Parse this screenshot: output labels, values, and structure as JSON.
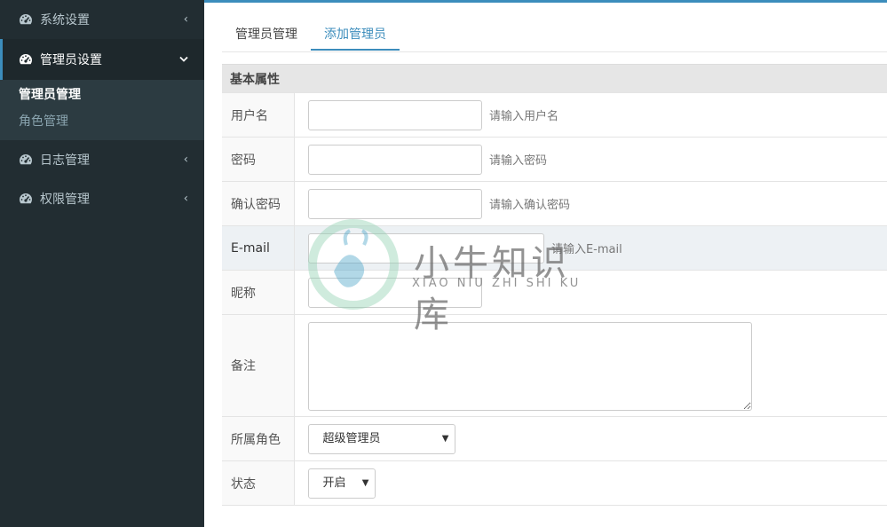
{
  "sidebar": {
    "items": [
      {
        "label": "系统设置",
        "caret": "‹"
      },
      {
        "label": "管理员设置",
        "caret": "⌄"
      },
      {
        "label": "日志管理",
        "caret": "‹"
      },
      {
        "label": "权限管理",
        "caret": "‹"
      }
    ],
    "submenu": [
      {
        "label": "管理员管理",
        "active": true
      },
      {
        "label": "角色管理",
        "active": false
      }
    ]
  },
  "tabs": [
    {
      "label": "管理员管理",
      "active": false
    },
    {
      "label": "添加管理员",
      "active": true
    }
  ],
  "form": {
    "section": "基本属性",
    "username": {
      "label": "用户名",
      "value": "",
      "hint": "请输入用户名"
    },
    "password": {
      "label": "密码",
      "value": "",
      "hint": "请输入密码"
    },
    "confirm": {
      "label": "确认密码",
      "value": "",
      "hint": "请输入确认密码"
    },
    "email": {
      "label": "E-mail",
      "value": "",
      "hint": "请输入E-mail"
    },
    "nickname": {
      "label": "昵称",
      "value": ""
    },
    "remark": {
      "label": "备注",
      "value": ""
    },
    "role": {
      "label": "所属角色",
      "selected": "超级管理员"
    },
    "status": {
      "label": "状态",
      "selected": "开启"
    }
  },
  "watermark": {
    "title": "小牛知识库",
    "subtitle": "XIAO NIU ZHI SHI KU"
  },
  "colors": {
    "sidebar_bg": "#222d32",
    "accent": "#3c8dbc",
    "section_bg": "#e6e6e6",
    "highlight_row": "#edf1f4"
  },
  "icons": {
    "menu": "dashboard-gauge-icon",
    "select": "caret-down-icon"
  }
}
